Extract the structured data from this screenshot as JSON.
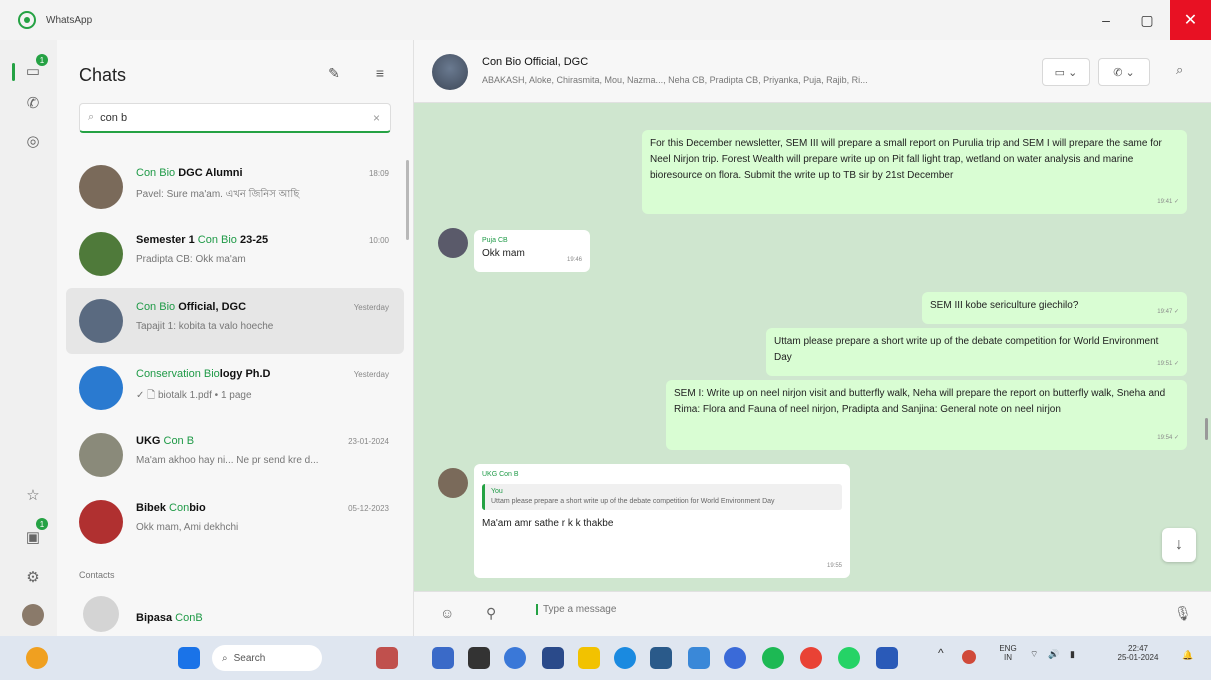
{
  "window": {
    "title": "WhatsApp",
    "minimize": "–",
    "maximize": "▢",
    "close": "✕"
  },
  "rail": {
    "chats_badge": "1",
    "updates_badge": "1"
  },
  "chatlist": {
    "title": "Chats",
    "search": {
      "value": "con b",
      "clear": "×"
    },
    "items": [
      {
        "name_pre": "",
        "name_hl": "Con Bio",
        "name_post": " DGC Alumni",
        "time": "18:09",
        "preview": "Pavel: Sure ma'am. এখন জিনিস আছি",
        "avatar_color": "#7a6a5a"
      },
      {
        "name_pre": "Semester 1 ",
        "name_hl": "Con Bio",
        "name_post": " 23-25",
        "time": "10:00",
        "preview": "Pradipta CB: Okk ma'am",
        "avatar_color": "#4f7a3a"
      },
      {
        "name_pre": "",
        "name_hl": "Con Bio",
        "name_post": " Official, DGC",
        "time": "Yesterday",
        "preview": "Tapajit 1: kobita ta valo hoeche",
        "avatar_color": "#5a6a80"
      },
      {
        "name_pre": "",
        "name_hl": "Conservation Bio",
        "name_post": "logy Ph.D",
        "time": "Yesterday",
        "preview": "✓ 🗋 biotalk 1.pdf • 1 page",
        "avatar_color": "#2a7ad0"
      },
      {
        "name_pre": "UKG ",
        "name_hl": "Con B",
        "name_post": "",
        "time": "23-01-2024",
        "preview": "Ma'am akhoo hay ni... Ne pr send kre d...",
        "avatar_color": "#8a8a7a"
      },
      {
        "name_pre": "Bibek ",
        "name_hl": "Con",
        "name_post": "bio",
        "time": "05-12-2023",
        "preview": "Okk mam, Ami dekhchi",
        "avatar_color": "#b03030"
      }
    ],
    "contacts_label": "Contacts",
    "contact": {
      "name_pre": "Bipasa ",
      "name_hl": "ConB",
      "avatar_color": "#cfcfcf"
    }
  },
  "chat": {
    "group_name": "Con Bio Official, DGC",
    "members": "ABAKASH, Aloke, Chirasmita, Mou, Nazma..., Neha CB, Pradipta CB, Priyanka, Puja, Rajib, Ri...",
    "video_btn": "▭ ⌄",
    "call_btn": "✆ ⌄",
    "messages": [
      {
        "dir": "out",
        "text": "For this December newsletter, SEM III will prepare a small report on Purulia trip and SEM I will prepare the same for Neel Nirjon trip. Forest Wealth will prepare write up on Pit fall light trap, wetland on water analysis and marine bioresource on flora. Submit the write up to TB sir by 21st December",
        "time": "19:41 ✓"
      },
      {
        "dir": "in",
        "sender": "Puja CB",
        "text": "Okk mam",
        "time": "19:46"
      },
      {
        "dir": "out",
        "text": "SEM III kobe sericulture giechilo?",
        "time": "19:47 ✓"
      },
      {
        "dir": "out",
        "text": "Uttam please prepare a short write up of the debate competition for World Environment Day",
        "time": "19:51 ✓"
      },
      {
        "dir": "out",
        "text": "SEM I: Write up on neel nirjon visit and butterfly walk, Neha will prepare the report on butterfly walk, Sneha and Rima: Flora and Fauna of neel nirjon, Pradipta and Sanjina: General note on neel nirjon",
        "time": "19:54 ✓"
      },
      {
        "dir": "in",
        "sender": "UKG Con B",
        "quote_sender": "You",
        "quote_text": "Uttam please prepare a short write up of the debate competition for World Environment Day",
        "text": "Ma'am amr sathe r k k thakbe",
        "time": "19:55"
      }
    ],
    "composer_placeholder": "Type a message"
  },
  "taskbar": {
    "search_label": "Search",
    "lang": "ENG",
    "lang_sub": "IN",
    "time": "22:47",
    "date": "25-01-2024"
  }
}
